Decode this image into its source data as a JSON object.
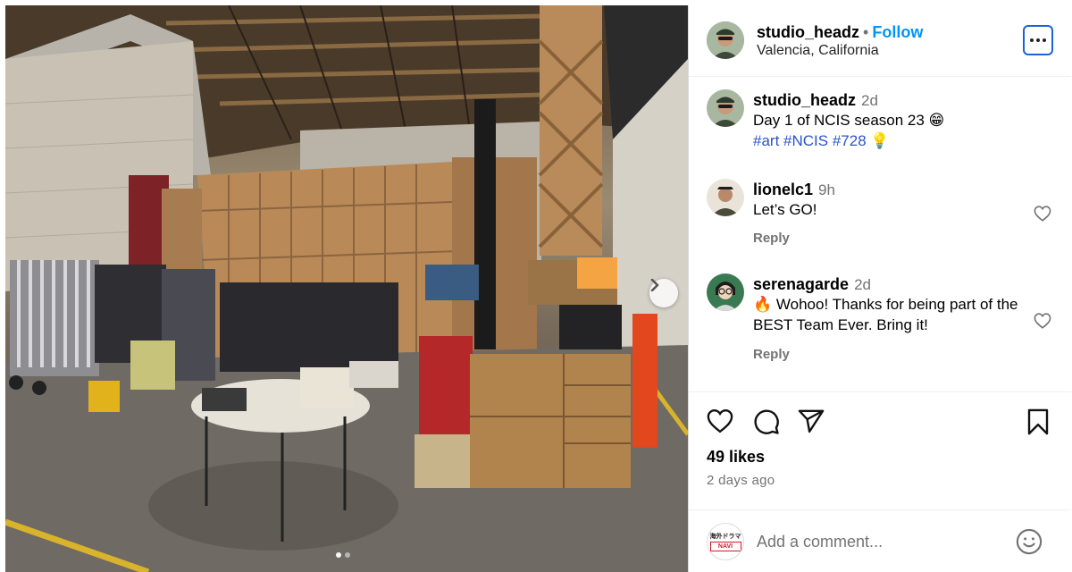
{
  "post": {
    "author": "studio_headz",
    "separator": "•",
    "follow_label": "Follow",
    "location": "Valencia, California"
  },
  "caption": {
    "author": "studio_headz",
    "time": "2d",
    "text": "Day 1 of NCIS season 23 😁",
    "tags": [
      "#art",
      "#NCIS",
      "#728"
    ],
    "tag_emoji": "💡"
  },
  "comments": [
    {
      "author": "lionelc1",
      "time": "9h",
      "text": "Let’s GO!",
      "reply_label": "Reply"
    },
    {
      "author": "serenagarde",
      "time": "2d",
      "emoji": "🔥",
      "text": "Wohoo! Thanks for being part of the BEST Team Ever. Bring it!",
      "reply_label": "Reply"
    }
  ],
  "stats": {
    "likes": "49 likes",
    "date": "2 days ago"
  },
  "composer": {
    "placeholder": "Add a comment...",
    "avatar_badge_top": "海外ドラマ",
    "avatar_badge_bottom": "NAVI"
  },
  "carousel": {
    "count": 2,
    "active": 1
  },
  "icons": {
    "more": "more-options-icon",
    "like": "heart-icon",
    "comment": "comment-bubble-icon",
    "share": "paper-plane-icon",
    "save": "bookmark-icon",
    "emoji": "smiley-icon",
    "next": "chevron-right-icon"
  },
  "colors": {
    "link": "#0095f6",
    "hashtag": "#2b53c8",
    "secondary": "#737373",
    "focus_ring": "#1d63d8"
  }
}
